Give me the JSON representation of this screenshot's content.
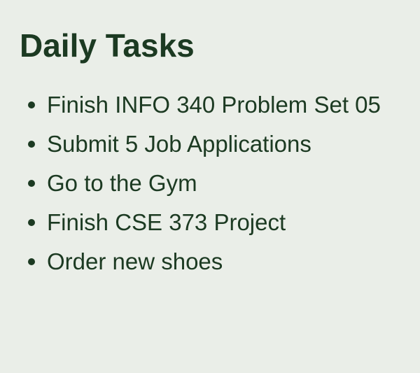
{
  "page": {
    "title": "Daily Tasks"
  },
  "tasks": [
    {
      "label": "Finish INFO 340 Problem Set 05"
    },
    {
      "label": "Submit 5 Job Applications"
    },
    {
      "label": "Go to the Gym"
    },
    {
      "label": "Finish CSE 373 Project"
    },
    {
      "label": "Order new shoes"
    }
  ],
  "colors": {
    "background": "#eaeee8",
    "text": "#1c3a22"
  }
}
